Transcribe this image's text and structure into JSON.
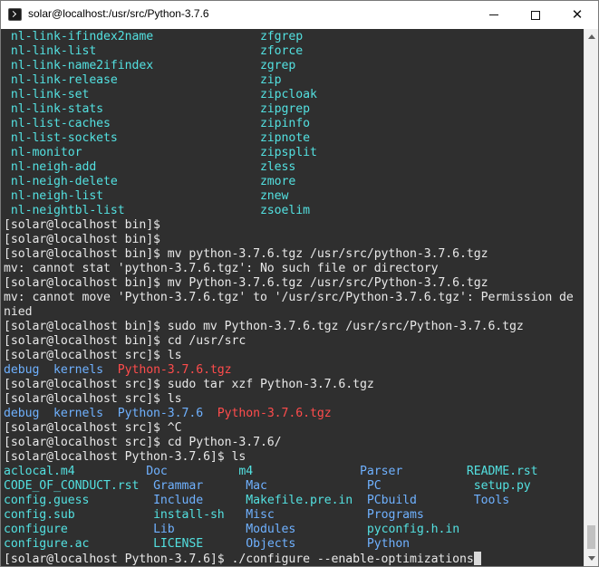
{
  "window": {
    "title": "solar@localhost:/usr/src/Python-3.7.6"
  },
  "terminal": {
    "lines": [
      [
        {
          "t": " nl-link-ifindex2name               zfgrep",
          "c": "cyan"
        }
      ],
      [
        {
          "t": " nl-link-list                       zforce",
          "c": "cyan"
        }
      ],
      [
        {
          "t": " nl-link-name2ifindex               zgrep",
          "c": "cyan"
        }
      ],
      [
        {
          "t": " nl-link-release                    zip",
          "c": "cyan"
        }
      ],
      [
        {
          "t": " nl-link-set                        zipcloak",
          "c": "cyan"
        }
      ],
      [
        {
          "t": " nl-link-stats                      zipgrep",
          "c": "cyan"
        }
      ],
      [
        {
          "t": " nl-list-caches                     zipinfo",
          "c": "cyan"
        }
      ],
      [
        {
          "t": " nl-list-sockets                    zipnote",
          "c": "cyan"
        }
      ],
      [
        {
          "t": " nl-monitor                         zipsplit",
          "c": "cyan"
        }
      ],
      [
        {
          "t": " nl-neigh-add                       zless",
          "c": "cyan"
        }
      ],
      [
        {
          "t": " nl-neigh-delete                    zmore",
          "c": "cyan"
        }
      ],
      [
        {
          "t": " nl-neigh-list                      znew",
          "c": "cyan"
        }
      ],
      [
        {
          "t": " nl-neightbl-list                   zsoelim",
          "c": "cyan"
        }
      ],
      [
        {
          "t": "[solar@localhost bin]$",
          "c": "white"
        }
      ],
      [
        {
          "t": "[solar@localhost bin]$",
          "c": "white"
        }
      ],
      [
        {
          "t": "[solar@localhost bin]$ mv python-3.7.6.tgz /usr/src/python-3.7.6.tgz",
          "c": "white"
        }
      ],
      [
        {
          "t": "mv: cannot stat 'python-3.7.6.tgz': No such file or directory",
          "c": "white"
        }
      ],
      [
        {
          "t": "[solar@localhost bin]$ mv Python-3.7.6.tgz /usr/src/Python-3.7.6.tgz",
          "c": "white"
        }
      ],
      [
        {
          "t": "mv: cannot move 'Python-3.7.6.tgz' to '/usr/src/Python-3.7.6.tgz': Permission de",
          "c": "white"
        }
      ],
      [
        {
          "t": "nied",
          "c": "white"
        }
      ],
      [
        {
          "t": "[solar@localhost bin]$ sudo mv Python-3.7.6.tgz /usr/src/Python-3.7.6.tgz",
          "c": "white"
        }
      ],
      [
        {
          "t": "[solar@localhost bin]$ cd /usr/src",
          "c": "white"
        }
      ],
      [
        {
          "t": "[solar@localhost src]$ ls",
          "c": "white"
        }
      ],
      [
        {
          "t": "debug  kernels  ",
          "c": "blue"
        },
        {
          "t": "Python-3.7.6.tgz",
          "c": "red"
        }
      ],
      [
        {
          "t": "[solar@localhost src]$ sudo tar xzf Python-3.7.6.tgz",
          "c": "white"
        }
      ],
      [
        {
          "t": "[solar@localhost src]$ ls",
          "c": "white"
        }
      ],
      [
        {
          "t": "debug  kernels  Python-3.7.6  ",
          "c": "blue"
        },
        {
          "t": "Python-3.7.6.tgz",
          "c": "red"
        }
      ],
      [
        {
          "t": "[solar@localhost src]$ ^C",
          "c": "white"
        }
      ],
      [
        {
          "t": "[solar@localhost src]$ cd Python-3.7.6/",
          "c": "white"
        }
      ],
      [
        {
          "t": "[solar@localhost Python-3.7.6]$ ls",
          "c": "white"
        }
      ],
      [
        {
          "t": "aclocal.m4          ",
          "c": "cyan"
        },
        {
          "t": "Doc",
          "c": "blue"
        },
        {
          "t": "          m4               ",
          "c": "cyan"
        },
        {
          "t": "Parser",
          "c": "blue"
        },
        {
          "t": "         README.rst",
          "c": "cyan"
        }
      ],
      [
        {
          "t": "CODE_OF_CONDUCT.rst  ",
          "c": "cyan"
        },
        {
          "t": "Grammar",
          "c": "blue"
        },
        {
          "t": "      Mac              ",
          "c": "blue"
        },
        {
          "t": "PC",
          "c": "blue"
        },
        {
          "t": "             setup.py",
          "c": "cyan"
        }
      ],
      [
        {
          "t": "config.guess         ",
          "c": "cyan"
        },
        {
          "t": "Include",
          "c": "blue"
        },
        {
          "t": "      Makefile.pre.in  ",
          "c": "cyan"
        },
        {
          "t": "PCbuild",
          "c": "blue"
        },
        {
          "t": "        Tools",
          "c": "blue"
        }
      ],
      [
        {
          "t": "config.sub           ",
          "c": "cyan"
        },
        {
          "t": "install-sh",
          "c": "cyan"
        },
        {
          "t": "   Misc             ",
          "c": "blue"
        },
        {
          "t": "Programs",
          "c": "blue"
        }
      ],
      [
        {
          "t": "configure            ",
          "c": "cyan"
        },
        {
          "t": "Lib",
          "c": "blue"
        },
        {
          "t": "          Modules          ",
          "c": "blue"
        },
        {
          "t": "pyconfig.h.in",
          "c": "cyan"
        }
      ],
      [
        {
          "t": "configure.ac         ",
          "c": "cyan"
        },
        {
          "t": "LICENSE",
          "c": "cyan"
        },
        {
          "t": "      Objects          ",
          "c": "blue"
        },
        {
          "t": "Python",
          "c": "blue"
        }
      ],
      [
        {
          "t": "[solar@localhost Python-3.7.6]$ ./configure --enable-optimizations",
          "c": "white"
        }
      ]
    ]
  },
  "colors": {
    "terminal_bg": "#2f2f2f",
    "text": "#e8e8e8",
    "cyan": "#53e0e0",
    "blue": "#6fb1ff",
    "red": "#ff4c4c"
  },
  "icons": {
    "app": "terminal-icon",
    "minimize": "minimize-icon",
    "maximize": "maximize-icon",
    "close": "close-icon"
  }
}
